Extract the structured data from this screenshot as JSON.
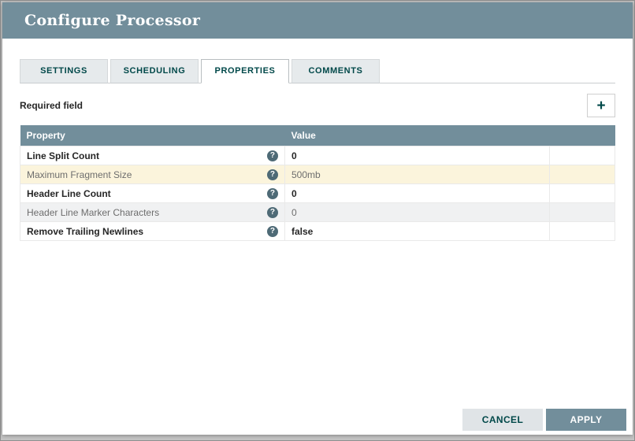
{
  "dialog": {
    "title": "Configure Processor",
    "tabs": [
      {
        "label": "SETTINGS",
        "active": false
      },
      {
        "label": "SCHEDULING",
        "active": false
      },
      {
        "label": "PROPERTIES",
        "active": true
      },
      {
        "label": "COMMENTS",
        "active": false
      }
    ],
    "required_field_label": "Required field",
    "icons": {
      "add": "+",
      "help": "?"
    },
    "table": {
      "columns": [
        "Property",
        "Value",
        ""
      ],
      "rows": [
        {
          "property": "Line Split Count",
          "value": "0",
          "required": true,
          "modified": false
        },
        {
          "property": "Maximum Fragment Size",
          "value": "500mb",
          "required": false,
          "modified": true
        },
        {
          "property": "Header Line Count",
          "value": "0",
          "required": true,
          "modified": false
        },
        {
          "property": "Header Line Marker Characters",
          "value": "0",
          "required": false,
          "modified": false
        },
        {
          "property": "Remove Trailing Newlines",
          "value": "false",
          "required": true,
          "modified": false
        }
      ]
    },
    "buttons": {
      "cancel": "CANCEL",
      "apply": "APPLY"
    },
    "colors": {
      "header_bg": "#728e9b",
      "accent": "#004849",
      "modified_row_bg": "#fbf4dc",
      "apply_button_bg": "#728e9b"
    }
  }
}
